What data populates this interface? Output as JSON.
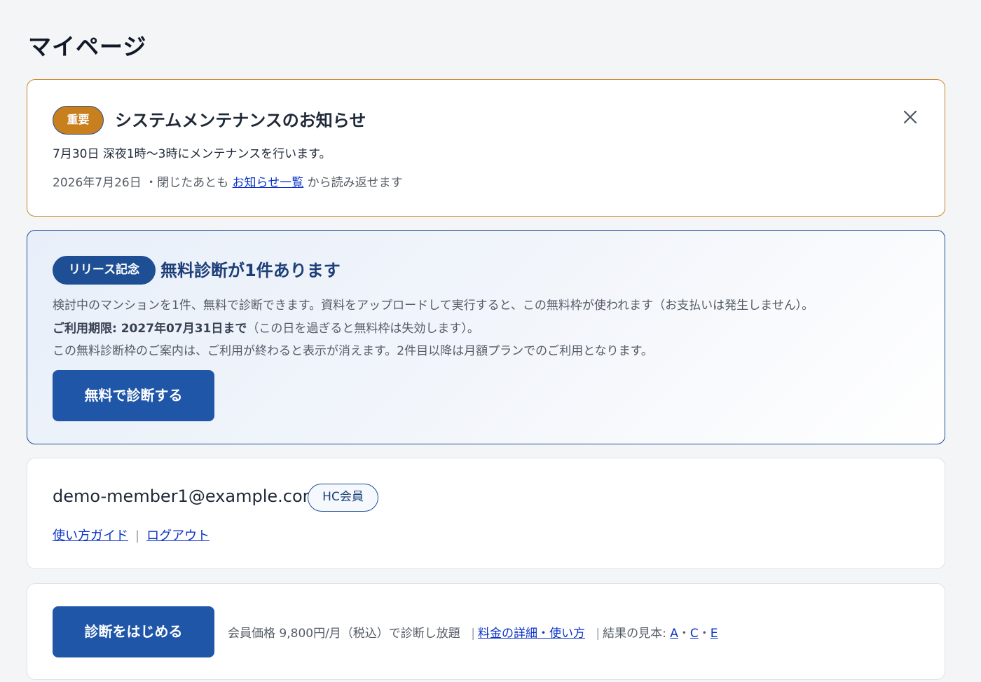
{
  "page": {
    "title": "マイページ"
  },
  "notice": {
    "badge": "重要",
    "title": "システムメンテナンスのお知らせ",
    "body": "7月30日 深夜1時〜3時にメンテナンスを行います。",
    "date": "2026年7月26日",
    "meta_prefix": "・閉じたあとも",
    "link": "お知らせ一覧",
    "meta_suffix": "から読み返せます",
    "close_icon": "close-icon"
  },
  "promo": {
    "badge": "リリース記念",
    "title": "無料診断が1件あります",
    "line1": "検討中のマンションを1件、無料で診断できます。資料をアップロードして実行すると、この無料枠が使われます（お支払いは発生しません）。",
    "deadline_bold": "ご利用期限: 2027年07月31日まで",
    "deadline_rest": "（この日を過ぎると無料枠は失効します）。",
    "line3": "この無料診断枠のご案内は、ご利用が終わると表示が消えます。2件目以降は月額プランでのご利用となります。",
    "button": "無料で診断する"
  },
  "account": {
    "email": "demo-member1@example.com",
    "member_badge": "HC会員",
    "links": {
      "guide": "使い方ガイド",
      "separator": "|",
      "logout": "ログアウト"
    }
  },
  "start": {
    "button": "診断をはじめる",
    "price": "会員価格 9,800円/月（税込）で診断し放題",
    "separator": "|",
    "pricing_link": "料金の詳細・使い方",
    "samples_label": "結果の見本:",
    "samples": [
      "A",
      "C",
      "E"
    ],
    "dot": "・"
  },
  "colors": {
    "important": "#c8801e",
    "primary": "#1f56a8",
    "release": "#1e4e94",
    "link": "#0b34c8"
  }
}
